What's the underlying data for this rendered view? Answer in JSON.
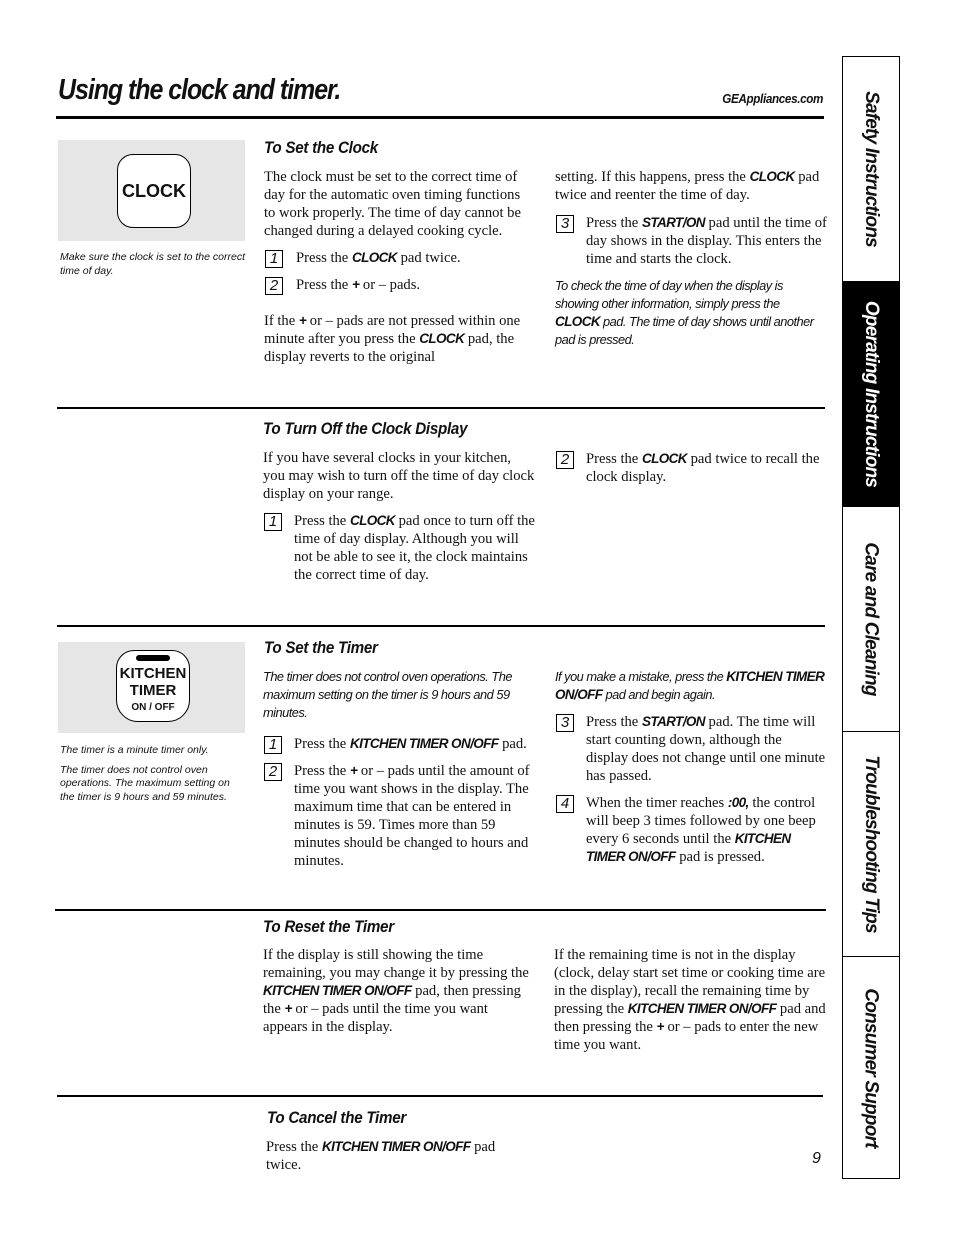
{
  "header": {
    "title": "Using the clock and timer.",
    "website": "GEAppliances.com"
  },
  "side_tabs": [
    {
      "label": "Safety Instructions",
      "active": false
    },
    {
      "label": "Operating Instructions",
      "active": true
    },
    {
      "label": "Care and Cleaning",
      "active": false
    },
    {
      "label": "Troubleshooting Tips",
      "active": false
    },
    {
      "label": "Consumer Support",
      "active": false
    }
  ],
  "clock_panel": {
    "pad_label": "CLOCK",
    "caption": "Make sure the clock is set to the correct time of day."
  },
  "timer_panel": {
    "pad_line1": "KITCHEN",
    "pad_line2": "TIMER",
    "pad_line3": "ON / OFF",
    "caption1": "The timer is a minute timer only.",
    "caption2": "The timer does not control oven operations. The maximum setting on the timer is 9 hours and 59 minutes."
  },
  "set_clock": {
    "heading": "To Set the Clock",
    "intro": "The clock must be set to the correct time of day for the automatic oven timing functions to work properly. The time of day cannot be changed during a delayed cooking cycle.",
    "step1": {
      "num": "1",
      "pre": "Press the ",
      "kw": "CLOCK",
      "post": " pad twice."
    },
    "step2": {
      "num": "2",
      "pre": "Press the ",
      "kw": "+",
      "post": " or – pads."
    },
    "warn": {
      "pre": "If the ",
      "kw1": "+",
      "mid": " or – pads are not pressed within one minute after you press the ",
      "kw2": "CLOCK",
      "post": " pad, the display reverts to the original setting. If this happens, press the "
    },
    "warn_col2": {
      "kw": "CLOCK",
      "post": " pad twice and reenter the time of day.",
      "pre": "setting. If this happens, press the "
    },
    "warn_col1": {
      "pre": "If the ",
      "kw1": "+",
      "mid": " or – pads are not pressed within one minute after you press the ",
      "kw2": "CLOCK",
      "post": " pad, the display reverts to the original"
    },
    "step3": {
      "num": "3",
      "pre": "Press the ",
      "kw": "START/ON",
      "post": " pad until the time of day shows in the display. This enters the time and starts the clock."
    },
    "note": {
      "pre": "To check the time of day when the display is showing other information, simply press the ",
      "kw": "CLOCK",
      "post": " pad. The time of day shows until another pad is pressed."
    }
  },
  "turn_off_display": {
    "heading": "To Turn Off the Clock Display",
    "intro": "If you have several clocks in your kitchen, you may wish to turn off the time of day clock display on your range.",
    "step1": {
      "num": "1",
      "pre": "Press the ",
      "kw": "CLOCK",
      "post": " pad once to turn off the time of day display. Although you will not be able to see it, the clock maintains the correct time of day."
    },
    "step2": {
      "num": "2",
      "pre": "Press the ",
      "kw": "CLOCK",
      "post": " pad twice to recall the clock display."
    }
  },
  "set_timer": {
    "heading": "To Set the Timer",
    "note": "The timer does not control oven operations. The maximum setting on the timer is 9 hours and 59 minutes.",
    "step1": {
      "num": "1",
      "pre": "Press the ",
      "kw": "KITCHEN TIMER ON/OFF",
      "post": " pad."
    },
    "step2": {
      "num": "2",
      "pre": "Press the ",
      "kw": "+",
      "post": " or – pads until the amount of time you want shows in the display. The maximum time that can be entered in minutes is 59. Times more than 59 minutes should be changed to hours and minutes."
    },
    "mistake": {
      "pre": "If you make a mistake, press the ",
      "kw": "KITCHEN TIMER ON/OFF",
      "post": " pad and begin again."
    },
    "step3": {
      "num": "3",
      "pre": "Press the ",
      "kw": "START/ON",
      "post": " pad. The time will start counting down, although the display does not change until one minute has passed."
    },
    "step4": {
      "num": "4",
      "pre": "When the timer reaches ",
      "kw": ":00,",
      "mid": " the control will beep 3 times followed by one beep every 6 seconds until the ",
      "kw2": "KITCHEN TIMER ON/OFF",
      "post": " pad is pressed."
    }
  },
  "reset_timer": {
    "heading": "To Reset the Timer",
    "col1": {
      "pre": "If the display is still showing the time remaining, you may change it by pressing the ",
      "kw": "KITCHEN TIMER ON/OFF",
      "mid": " pad, then pressing the ",
      "kw2": "+",
      "post": " or – pads until the time you want appears in the display."
    },
    "col2": {
      "pre": "If the remaining time is not in the display (clock, delay start set time or cooking time are in the display), recall the remaining time by pressing the ",
      "kw": "KITCHEN TIMER ON/OFF",
      "mid": " pad and then pressing the ",
      "kw2": "+",
      "post": " or – pads to enter the new time you want."
    }
  },
  "cancel_timer": {
    "heading": "To Cancel the Timer",
    "body": {
      "pre": "Press the ",
      "kw": "KITCHEN TIMER ON/OFF",
      "post": " pad twice."
    }
  },
  "page_number": "9"
}
